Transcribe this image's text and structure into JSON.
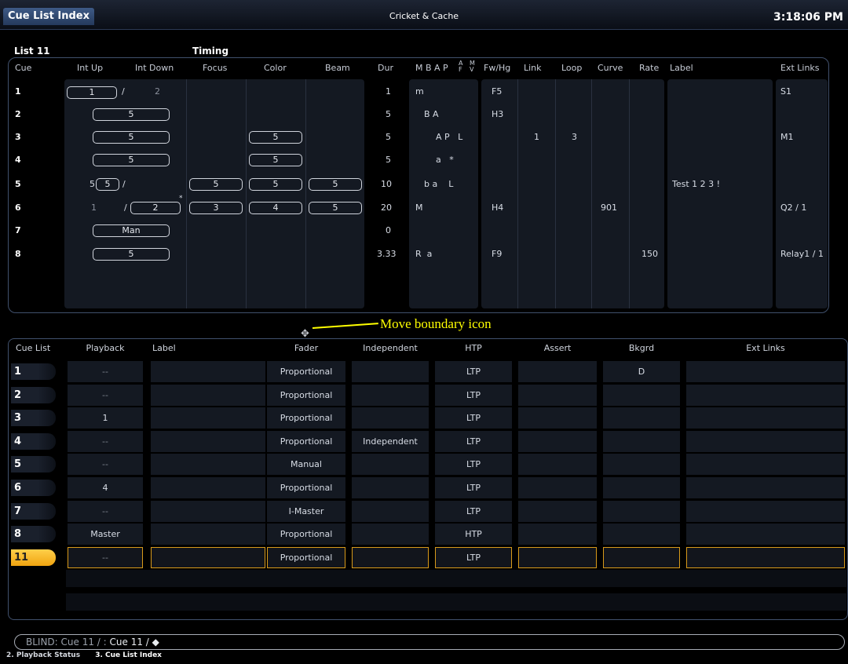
{
  "window": {
    "tab_title": "Cue List Index",
    "show_name": "Cricket & Cache",
    "clock": "3:18:06 PM"
  },
  "cue_list": {
    "list_label": "List 11",
    "timing_label": "Timing",
    "columns": [
      "Cue",
      "Int Up",
      "Int Down",
      "Focus",
      "Color",
      "Beam",
      "Dur",
      "M B A P",
      "A F",
      "M V",
      "Fw/Hg",
      "Link",
      "Loop",
      "Curve",
      "Rate",
      "Label",
      "Ext Links"
    ],
    "rows": [
      {
        "cue": "1",
        "int_up": "1",
        "int_down": "2",
        "focus": "",
        "color": "",
        "beam": "",
        "dur": "1",
        "flags": "m",
        "fwhg": "F5",
        "link": "",
        "loop": "",
        "curve": "",
        "rate": "",
        "label": "",
        "ext": "S1"
      },
      {
        "cue": "2",
        "int_up": "5",
        "int_down": "",
        "focus": "",
        "color": "",
        "beam": "",
        "dur": "5",
        "flags": "B A",
        "fwhg": "H3",
        "link": "",
        "loop": "",
        "curve": "",
        "rate": "",
        "label": "",
        "ext": ""
      },
      {
        "cue": "3",
        "int_up": "5",
        "int_down": "",
        "focus": "",
        "color": "5",
        "beam": "",
        "dur": "5",
        "flags": "A P   L",
        "fwhg": "",
        "link": "1",
        "loop": "3",
        "curve": "",
        "rate": "",
        "label": "",
        "ext": "M1"
      },
      {
        "cue": "4",
        "int_up": "5",
        "int_down": "",
        "focus": "",
        "color": "5",
        "beam": "",
        "dur": "5",
        "flags": "a   *",
        "fwhg": "",
        "link": "",
        "loop": "",
        "curve": "",
        "rate": "",
        "label": "",
        "ext": ""
      },
      {
        "cue": "5",
        "int_up_prefix": "5",
        "int_up": "5",
        "int_down": "",
        "focus": "5",
        "color": "5",
        "beam": "5",
        "dur": "10",
        "flags": "b a    L",
        "fwhg": "",
        "link": "",
        "loop": "",
        "curve": "",
        "rate": "",
        "label": "Test 1 2 3 !",
        "ext": ""
      },
      {
        "cue": "6",
        "int_up": "1",
        "int_down": "2",
        "focus": "3",
        "color": "4",
        "beam": "5",
        "dur": "20",
        "flags": "M",
        "fwhg": "H4",
        "link": "",
        "loop": "",
        "curve": "901",
        "rate": "",
        "label": "",
        "ext": "Q2 / 1"
      },
      {
        "cue": "7",
        "int_up": "Man",
        "int_down": "",
        "focus": "",
        "color": "",
        "beam": "",
        "dur": "0",
        "flags": "",
        "fwhg": "",
        "link": "",
        "loop": "",
        "curve": "",
        "rate": "",
        "label": "",
        "ext": ""
      },
      {
        "cue": "8",
        "int_up": "5",
        "int_down": "",
        "focus": "",
        "color": "",
        "beam": "",
        "dur": "3.33",
        "flags": "R  a",
        "fwhg": "F9",
        "link": "",
        "loop": "",
        "curve": "",
        "rate": "150",
        "label": "",
        "ext": "Relay1 / 1"
      }
    ]
  },
  "annotation": "Move boundary icon",
  "index": {
    "columns": [
      "Cue List",
      "Playback",
      "Label",
      "Fader",
      "Independent",
      "HTP",
      "Assert",
      "Bkgrd",
      "Ext Links"
    ],
    "rows": [
      {
        "list": "1",
        "playback": "--",
        "label": "",
        "fader": "Proportional",
        "independent": "",
        "htp": "LTP",
        "assert": "",
        "bkgrd": "D",
        "ext": ""
      },
      {
        "list": "2",
        "playback": "--",
        "label": "",
        "fader": "Proportional",
        "independent": "",
        "htp": "LTP",
        "assert": "",
        "bkgrd": "",
        "ext": ""
      },
      {
        "list": "3",
        "playback": "1",
        "label": "",
        "fader": "Proportional",
        "independent": "",
        "htp": "LTP",
        "assert": "",
        "bkgrd": "",
        "ext": ""
      },
      {
        "list": "4",
        "playback": "--",
        "label": "",
        "fader": "Proportional",
        "independent": "Independent",
        "htp": "LTP",
        "assert": "",
        "bkgrd": "",
        "ext": ""
      },
      {
        "list": "5",
        "playback": "--",
        "label": "",
        "fader": "Manual",
        "independent": "",
        "htp": "LTP",
        "assert": "",
        "bkgrd": "",
        "ext": ""
      },
      {
        "list": "6",
        "playback": "4",
        "label": "",
        "fader": "Proportional",
        "independent": "",
        "htp": "LTP",
        "assert": "",
        "bkgrd": "",
        "ext": ""
      },
      {
        "list": "7",
        "playback": "--",
        "label": "",
        "fader": "I-Master",
        "independent": "",
        "htp": "LTP",
        "assert": "",
        "bkgrd": "",
        "ext": ""
      },
      {
        "list": "8",
        "playback": "Master",
        "label": "",
        "fader": "Proportional",
        "independent": "",
        "htp": "HTP",
        "assert": "",
        "bkgrd": "",
        "ext": ""
      },
      {
        "list": "11",
        "playback": "--",
        "label": "",
        "fader": "Proportional",
        "independent": "",
        "htp": "LTP",
        "assert": "",
        "bkgrd": "",
        "ext": "",
        "selected": true
      }
    ]
  },
  "command_line": {
    "mode": "BLIND: Cue  11 / :",
    "text": "Cue 11 / ◆"
  },
  "bottom_tabs": [
    "2. Playback Status",
    "3. Cue List Index"
  ]
}
